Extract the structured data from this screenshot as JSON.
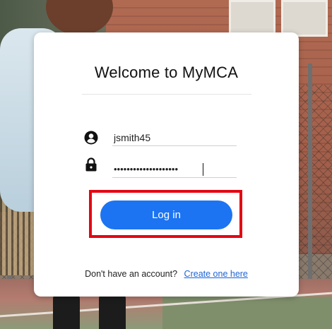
{
  "login": {
    "title": "Welcome to MyMCA",
    "username_value": "jsmith45",
    "password_value": "••••••••••••••••••••",
    "login_label": "Log in",
    "signup_prompt": "Don't have an account?",
    "signup_link": "Create one here"
  },
  "icons": {
    "user": "account-circle-icon",
    "lock": "lock-icon"
  },
  "colors": {
    "button": "#1c74f2",
    "highlight": "#e30613",
    "link": "#1c64d6"
  }
}
